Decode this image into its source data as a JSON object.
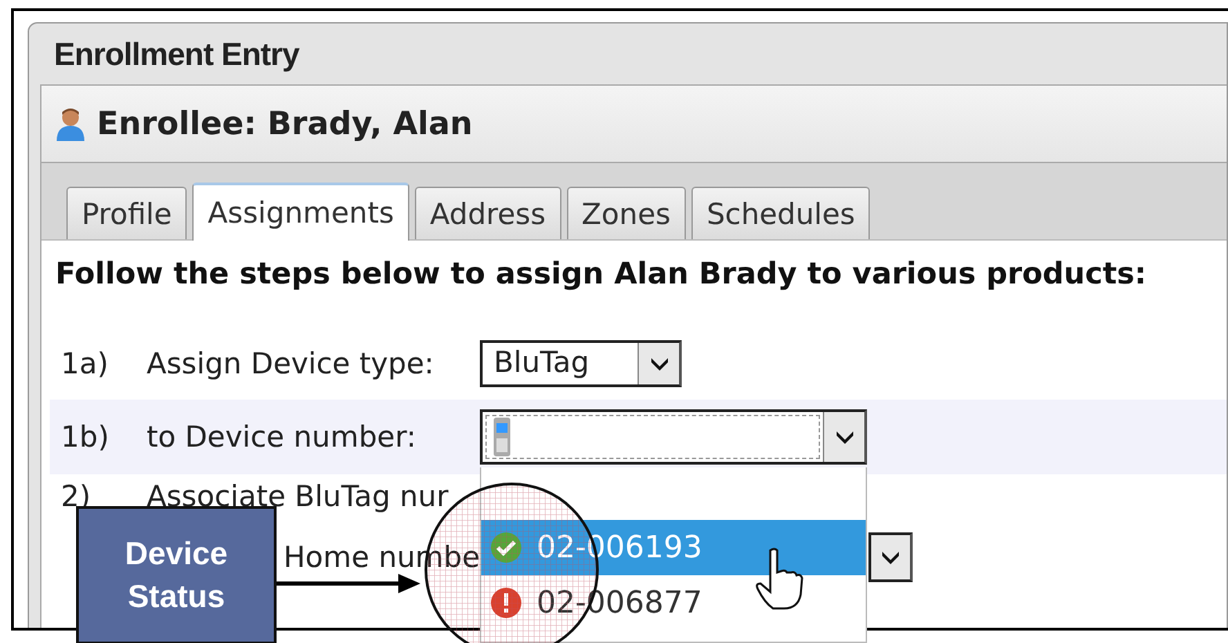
{
  "window": {
    "title": "Enrollment Entry"
  },
  "enrollee": {
    "label": "Enrollee: Brady, Alan"
  },
  "tabs": [
    {
      "label": "Profile",
      "selected": false
    },
    {
      "label": "Assignments",
      "selected": true
    },
    {
      "label": "Address",
      "selected": false
    },
    {
      "label": "Zones",
      "selected": false
    },
    {
      "label": "Schedules",
      "selected": false
    }
  ],
  "instructions": "Follow the steps below to assign Alan Brady to various products:",
  "steps": [
    {
      "number": "1a)",
      "label": "Assign Device type:",
      "kind": "select",
      "value": "BluTag",
      "highlighted": false
    },
    {
      "number": "1b)",
      "label": "to Device number:",
      "kind": "device-select",
      "highlighted": true
    },
    {
      "number": "2)",
      "label": "Associate BluTag nur",
      "kind": "text",
      "highlighted": false
    },
    {
      "label": "Home numbe",
      "kind": "short-select",
      "highlighted": false
    }
  ],
  "dropdown": {
    "items": [
      {
        "value": "02-006193",
        "kind": "ok",
        "selected": true
      },
      {
        "value": "02-006877",
        "kind": "error",
        "selected": false
      }
    ]
  },
  "callout": {
    "text": "Device Status"
  }
}
